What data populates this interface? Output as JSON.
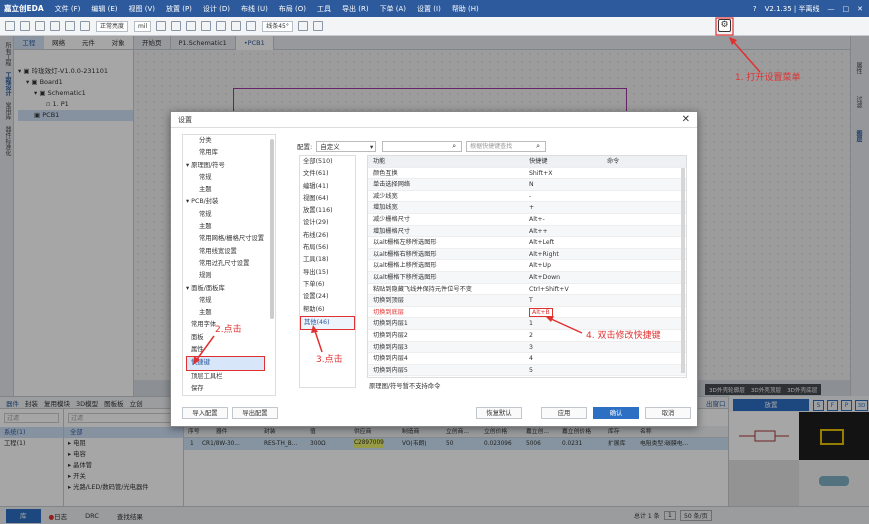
{
  "menubar": {
    "logo": "嘉立创EDA",
    "items": [
      "文件 (F)",
      "编辑 (E)",
      "视图 (V)",
      "放置 (P)",
      "设计 (D)",
      "布线 (U)",
      "布局 (O)",
      "工具",
      "导出 (R)",
      "下单 (A)",
      "设置 (I)",
      "帮助 (H)"
    ],
    "version": "V2.1.35 | 半离线"
  },
  "toolbar": {
    "select1": "正常亮度",
    "select2": "mil",
    "select3": "线条45°",
    "gear_icon": "gear-icon"
  },
  "left": {
    "vtabs": [
      "所有工程",
      "工程设计",
      "常用库",
      "器件标准化"
    ],
    "tabs": [
      "工程",
      "网络",
      "元件",
      "对象"
    ],
    "tree": [
      "玲珑效灯-V1.0.0-231101",
      "Board1",
      "Schematic1",
      "1. P1",
      "PCB1"
    ]
  },
  "doctabs": [
    "开始页",
    "P1.Schematic1",
    "•PCB1"
  ],
  "righttabs": [
    "属性",
    "过滤",
    "图层"
  ],
  "bottom": {
    "tabs": [
      "器件",
      "封装",
      "复用模块",
      "3D模型",
      "图板板",
      "立创"
    ],
    "left": {
      "filter": "过滤",
      "items": [
        "系统(1)",
        "工程(1)"
      ]
    },
    "cats": {
      "filter": "过滤",
      "items": [
        "全部",
        "电阻",
        "电容",
        "晶体管",
        "开关",
        "光路/LED/数码管/光电器件"
      ]
    },
    "headers": [
      "序号",
      "器件",
      "封装",
      "值",
      "供应商",
      "制造商",
      "立创商...",
      "立创价格",
      "嘉立创...",
      "嘉立创价格",
      "库存",
      "名称"
    ],
    "row": [
      "1",
      "CR1/8W-30...",
      "RES-TH_B...",
      "300Ω",
      "C2897009",
      "VO(韦朗)",
      "50",
      "0.023096",
      "5006",
      "0.0231",
      "扩展库",
      "电阻类型:碳膜电..."
    ],
    "pageinfo": "总计 1 条",
    "pagenum": "1",
    "perpage": "50 条/页",
    "layers": [
      "3D外壳轮廓层",
      "3D外壳顶层",
      "3D外壳底层"
    ],
    "place": "放置",
    "sidebtns": [
      "S",
      "F",
      "P",
      "3D"
    ],
    "doc_window": "出窗口"
  },
  "statusbar": {
    "tabs": [
      "库",
      "日志",
      "DRC",
      "查找结果"
    ]
  },
  "dialog": {
    "title": "设置",
    "tree": [
      "分类",
      "常用库",
      "原理图/符号",
      "常规",
      "主题",
      "PCB/封装",
      "常规",
      "主题",
      "常用网格/栅格尺寸设置",
      "常用线宽设置",
      "常用过孔尺寸设置",
      "规则",
      "面板/面板库",
      "常规",
      "主题",
      "常用字体",
      "面板",
      "属性",
      "快捷键",
      "顶层工具栏",
      "保存"
    ],
    "config_label": "配置:",
    "config_value": "自定义",
    "search_placeholder": "根据快捷键查找",
    "cats": [
      "全部(510)",
      "文件(61)",
      "编辑(41)",
      "视图(64)",
      "放置(116)",
      "设计(29)",
      "布线(26)",
      "布局(56)",
      "工具(18)",
      "导出(15)",
      "下单(6)",
      "设置(24)",
      "帮助(6)",
      "其他(46)"
    ],
    "table_head": [
      "功能",
      "快捷键",
      "命令"
    ],
    "rows": [
      [
        "颜色互换",
        "Shift+X"
      ],
      [
        "单击选择网络",
        "N"
      ],
      [
        "减少线宽",
        "-"
      ],
      [
        "增加线宽",
        "+"
      ],
      [
        "减少栅格尺寸",
        "Alt+-"
      ],
      [
        "增加栅格尺寸",
        "Alt++"
      ],
      [
        "以alt栅格左移所选图形",
        "Alt+Left"
      ],
      [
        "以alt栅格右移所选图形",
        "Alt+Right"
      ],
      [
        "以alt栅格上移所选图形",
        "Alt+Up"
      ],
      [
        "以alt栅格下移所选图形",
        "Alt+Down"
      ],
      [
        "粘贴到隐藏飞线并保持元件位号不变",
        "Ctrl+Shift+V"
      ],
      [
        "切换到顶层",
        "T"
      ],
      [
        "切换到底层",
        "Alt+B"
      ],
      [
        "切换到内层1",
        "1"
      ],
      [
        "切换到内层2",
        "2"
      ],
      [
        "切换到内层3",
        "3"
      ],
      [
        "切换到内层4",
        "4"
      ],
      [
        "切换到内层5",
        "5"
      ]
    ],
    "note": "原理图/符号暂不支持命令",
    "buttons": {
      "import": "导入配置",
      "export": "导出配置",
      "restore": "恢复默认",
      "apply": "应用",
      "ok": "确认",
      "cancel": "取消"
    }
  },
  "annotations": {
    "a1": "1. 打开设置菜单",
    "a2": "2.点击",
    "a3": "3.点击",
    "a4": "4. 双击修改快捷键"
  },
  "colors": {
    "accent": "#2c5a9c",
    "annotation": "#e03131",
    "board": "#9d3a9d"
  }
}
